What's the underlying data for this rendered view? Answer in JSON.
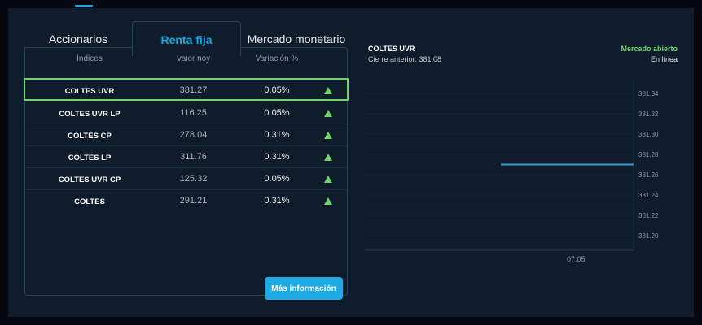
{
  "tabs": [
    "Accionarios",
    "Renta fija",
    "Mercado monetario"
  ],
  "table": {
    "headers": [
      "Índices",
      "Valor hoy",
      "Variación %"
    ],
    "rows": [
      {
        "name": "COLTES UVR",
        "value": "381.27",
        "change": "0.05%"
      },
      {
        "name": "COLTES UVR LP",
        "value": "116.25",
        "change": "0.05%"
      },
      {
        "name": "COLTES CP",
        "value": "278.04",
        "change": "0.31%"
      },
      {
        "name": "COLTES LP",
        "value": "311.76",
        "change": "0.31%"
      },
      {
        "name": "COLTES UVR CP",
        "value": "125.32",
        "change": "0.05%"
      },
      {
        "name": "COLTES",
        "value": "291.21",
        "change": "0.31%"
      }
    ]
  },
  "more_info_label": "Más información",
  "chart": {
    "title": "COLTES UVR",
    "previous_close": "Cierre anterior: 381.08",
    "market_status": "Mercado abierto",
    "connection": "En línea",
    "x_tick": "07:05",
    "y_ticks": [
      "381.34",
      "381.32",
      "381.30",
      "381.28",
      "381.26",
      "381.24",
      "381.22",
      "381.20"
    ],
    "line_value": 381.27
  },
  "colors": {
    "accent": "#1aa7e0",
    "up": "#6fd46a",
    "background": "#0e1c2b"
  }
}
